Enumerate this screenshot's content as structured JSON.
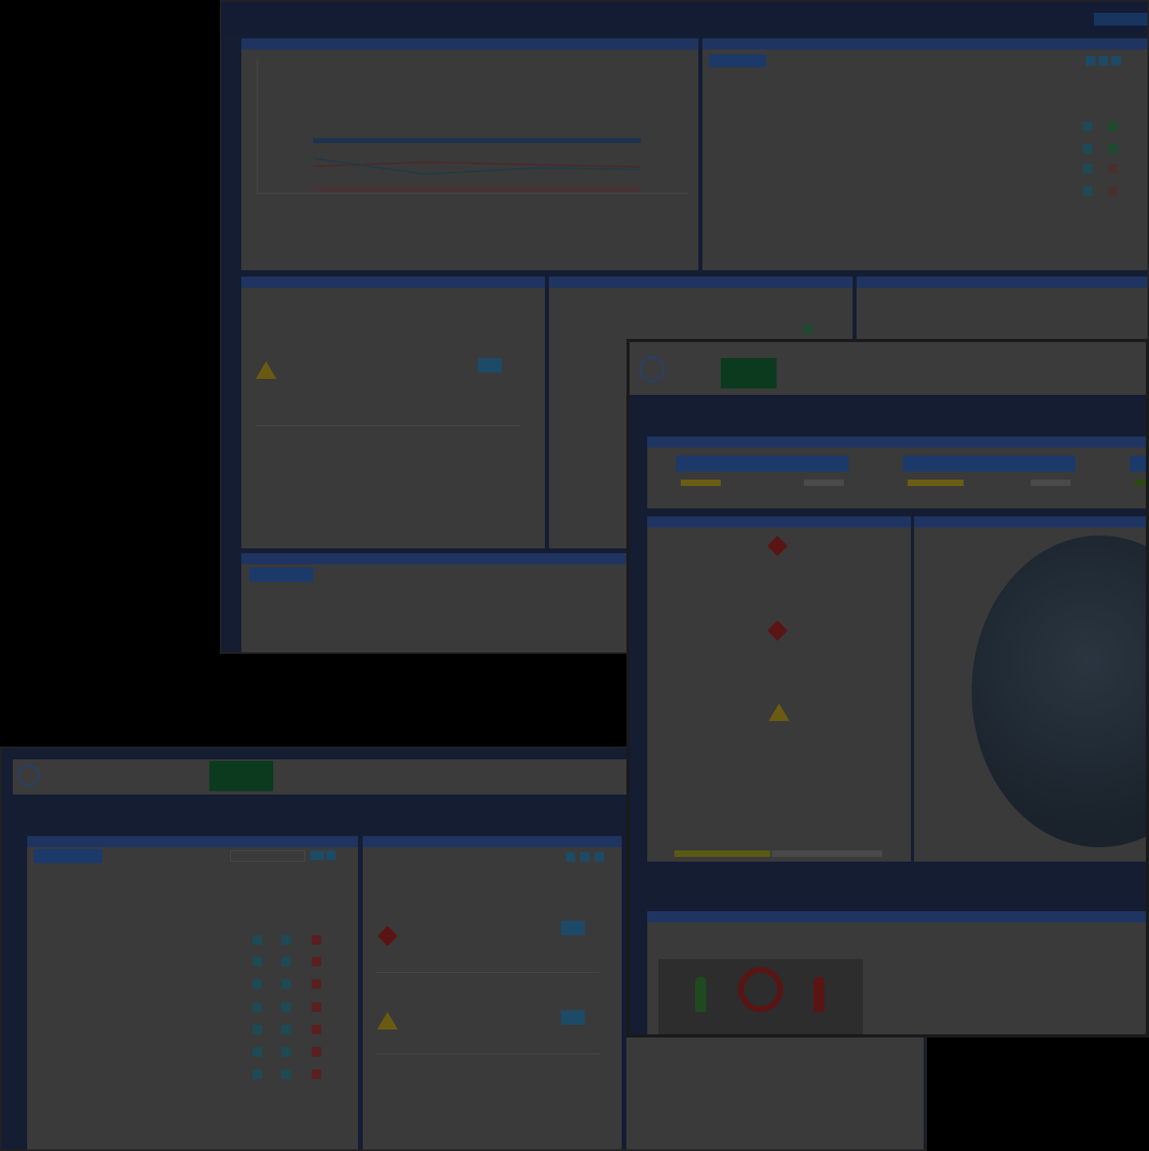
{
  "shot1": {
    "chart_panel": {
      "title": "",
      "legend": ""
    },
    "table_panel": {
      "add_button": "",
      "paging": "",
      "columns": [
        "",
        "",
        "",
        "",
        "",
        ""
      ],
      "rows": [
        [
          "",
          "",
          "",
          "",
          "",
          ""
        ],
        [
          "",
          "",
          "",
          "",
          "",
          ""
        ],
        [
          "",
          "",
          "",
          "",
          "",
          ""
        ],
        [
          "",
          "",
          "",
          "",
          "",
          ""
        ]
      ]
    },
    "alert_panel": {
      "title": "",
      "date": "",
      "item_title": "",
      "item_date": "",
      "item_body": ""
    },
    "middle_panel": {
      "title": "",
      "date": "",
      "label1": "",
      "value1": "",
      "label2": "",
      "value2": "",
      "label3": "",
      "value3": "",
      "item_date": ""
    },
    "right_panel": {
      "title": "",
      "date": "",
      "label1": "",
      "item_date": ""
    },
    "bottom_panel": {
      "title": "",
      "button": "",
      "columns": [
        "",
        "",
        "",
        "",
        ""
      ],
      "row": [
        "",
        "",
        "",
        "",
        ""
      ]
    }
  },
  "shot2": {
    "tabs": [
      "",
      "",
      "",
      "",
      ""
    ],
    "active_tab": 0,
    "cards": [
      {
        "button": "",
        "level": ""
      },
      {
        "button": "",
        "level": ""
      }
    ],
    "alerts": [
      {
        "title": "",
        "body": ""
      },
      {
        "title": "",
        "body": ""
      },
      {
        "title": "",
        "body": ""
      },
      {
        "title": "",
        "body": ""
      }
    ],
    "news_title": "",
    "news_body": ""
  },
  "shot3": {
    "tabs": [
      "",
      "",
      "",
      "",
      ""
    ],
    "active_tab": 2,
    "table_panel": {
      "button": "",
      "search_placeholder": "",
      "columns": [
        "",
        "",
        ""
      ],
      "rows": [
        [
          "",
          "",
          ""
        ],
        [
          "",
          "",
          ""
        ],
        [
          "",
          "",
          ""
        ],
        [
          "",
          "",
          ""
        ],
        [
          "",
          "",
          ""
        ],
        [
          "",
          "",
          ""
        ],
        [
          "",
          "",
          ""
        ]
      ]
    },
    "alert_panel": {
      "item1_title": "",
      "item1_date": "",
      "item1_body": "",
      "item2_title": "",
      "item2_date": "",
      "item2_body": ""
    }
  }
}
